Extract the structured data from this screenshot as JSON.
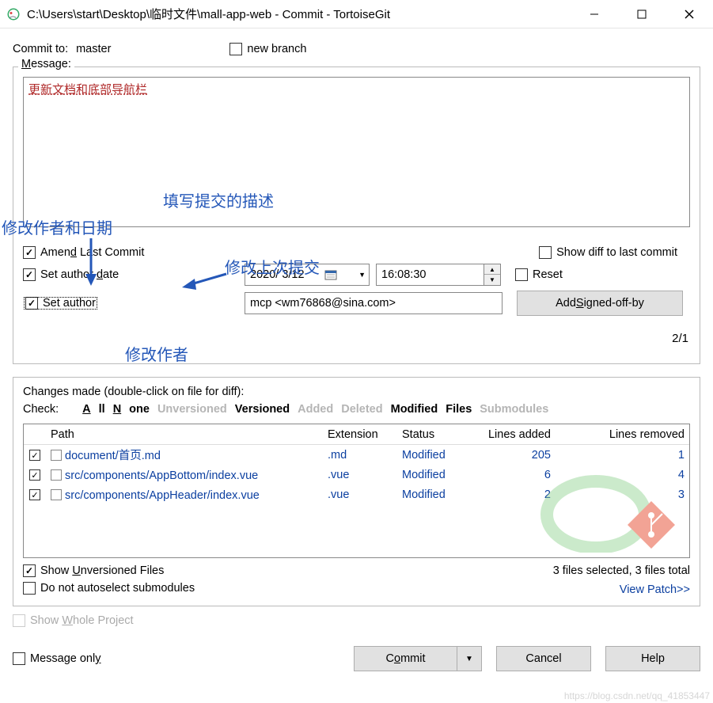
{
  "title": "C:\\Users\\start\\Desktop\\临时文件\\mall-app-web - Commit - TortoiseGit",
  "commit_to_label": "Commit to:",
  "branch": "master",
  "new_branch_label": "new branch",
  "message_label": "Message:",
  "message_text": "更新文档和底部导航栏",
  "counter": "2/1",
  "amend_last_commit": "Amend Last Commit",
  "show_diff_last": "Show diff to last commit",
  "set_author_date": "Set author date",
  "set_author": "Set author",
  "date_value": "2020/ 3/12",
  "time_value": "16:08:30",
  "reset_label": "Reset",
  "author_value": "mcp <wm76868@sina.com>",
  "add_signed_off": "Add Signed-off-by",
  "changes_header": "Changes made (double-click on file for diff):",
  "check_label": "Check:",
  "filters": {
    "all": "All",
    "none": "None",
    "unversioned": "Unversioned",
    "versioned": "Versioned",
    "added": "Added",
    "deleted": "Deleted",
    "modified": "Modified",
    "files": "Files",
    "submodules": "Submodules"
  },
  "columns": {
    "path": "Path",
    "ext": "Extension",
    "status": "Status",
    "added": "Lines added",
    "removed": "Lines removed"
  },
  "files": [
    {
      "path": "document/首页.md",
      "ext": ".md",
      "status": "Modified",
      "added": "205",
      "removed": "1"
    },
    {
      "path": "src/components/AppBottom/index.vue",
      "ext": ".vue",
      "status": "Modified",
      "added": "6",
      "removed": "4"
    },
    {
      "path": "src/components/AppHeader/index.vue",
      "ext": ".vue",
      "status": "Modified",
      "added": "2",
      "removed": "3"
    }
  ],
  "files_summary": "3 files selected, 3 files total",
  "show_unversioned": "Show Unversioned Files",
  "no_autoselect_sub": "Do not autoselect submodules",
  "view_patch": "View Patch>>",
  "show_whole_project": "Show Whole Project",
  "message_only": "Message only",
  "commit_btn": "Commit",
  "cancel_btn": "Cancel",
  "help_btn": "Help",
  "annot1": "填写提交的描述",
  "annot2": "修改作者和日期",
  "annot3": "修改上次提交",
  "annot4": "修改作者",
  "watermark": "https://blog.csdn.net/qq_41853447"
}
